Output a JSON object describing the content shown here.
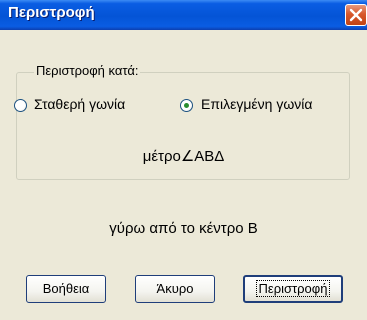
{
  "window": {
    "title": "Περιστροφή",
    "close_icon": "close-icon"
  },
  "group": {
    "legend": "Περιστροφή κατά:",
    "options": [
      {
        "label": "Σταθερή γωνία",
        "selected": false
      },
      {
        "label": "Επιλεγμένη γωνία",
        "selected": true
      }
    ],
    "measure_text": "μέτρο∠ΑΒΔ"
  },
  "center_text": "γύρω από το κέντρο Β",
  "buttons": {
    "help": "Βοήθεια",
    "cancel": "Άκυρο",
    "rotate": "Περιστροφή"
  },
  "colors": {
    "titlebar": "#0454d6",
    "background": "#ece9d8",
    "close_button": "#d8582c"
  }
}
